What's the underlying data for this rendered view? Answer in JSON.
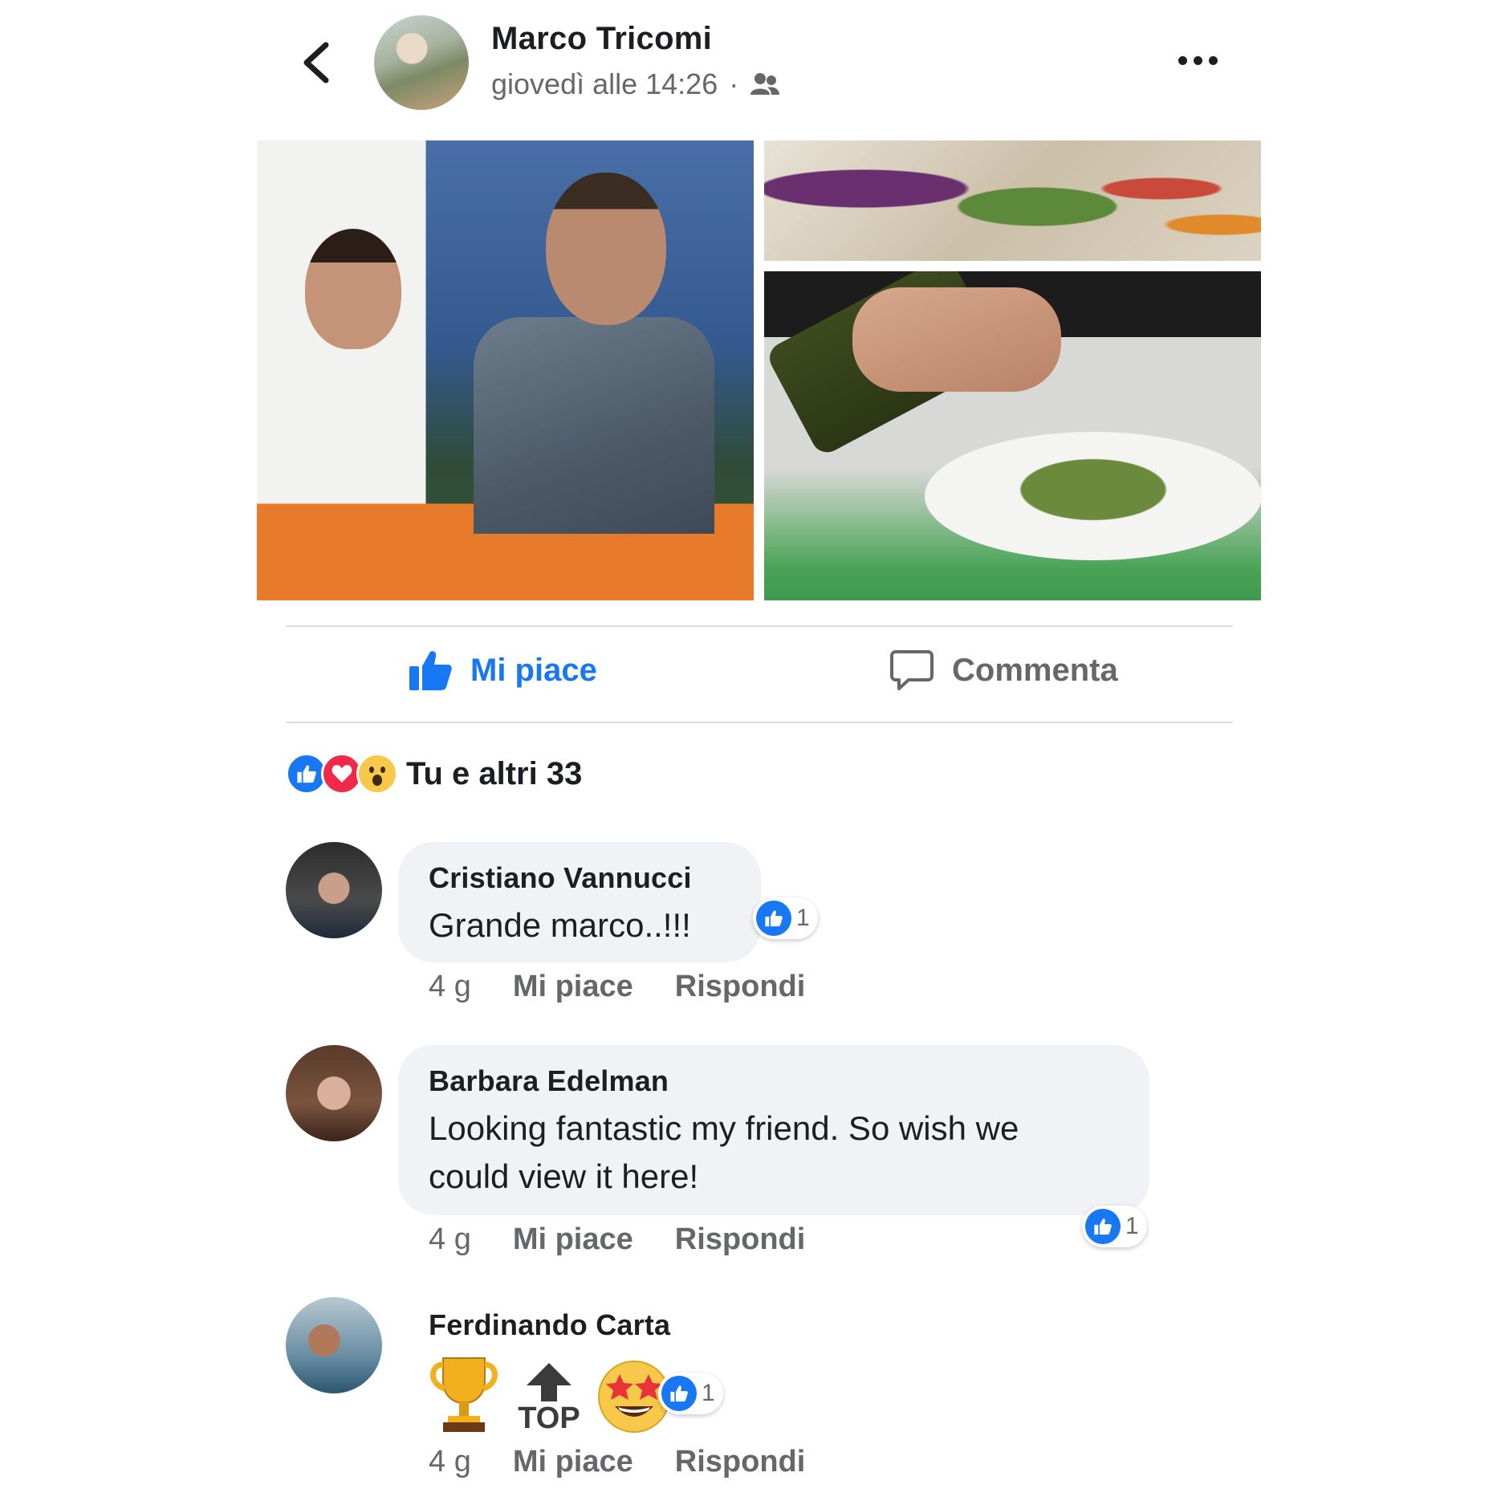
{
  "post": {
    "author": "Marco Tricomi",
    "timestamp": "giovedì alle 14:26",
    "separator": "·",
    "audience_icon": "friends-icon",
    "more_icon": "more-dots-icon",
    "back_icon": "chevron-left-icon"
  },
  "actions": {
    "like_label": "Mi piace",
    "comment_label": "Commenta"
  },
  "reactions": {
    "icons": [
      "like",
      "love",
      "wow"
    ],
    "summary": "Tu e altri 33"
  },
  "comments": [
    {
      "author": "Cristiano Vannucci",
      "text": "Grande marco..!!!",
      "reaction_count": "1",
      "time": "4 g",
      "like": "Mi piace",
      "reply": "Rispondi"
    },
    {
      "author": "Barbara Edelman",
      "text_line1": "Looking fantastic my friend. So wish we",
      "text_line2": "could view it here!",
      "reaction_count": "1",
      "time": "4 g",
      "like": "Mi piace",
      "reply": "Rispondi"
    },
    {
      "author": "Ferdinando Carta",
      "emojis": [
        "trophy",
        "top-arrow",
        "star-struck"
      ],
      "top_text": "TOP",
      "reaction_count": "1",
      "time": "4 g",
      "like": "Mi piace",
      "reply": "Rispondi"
    }
  ],
  "colors": {
    "accent": "#1877f2",
    "secondary_text": "#65676b",
    "bubble": "#f0f2f5",
    "love": "#f0284a"
  }
}
